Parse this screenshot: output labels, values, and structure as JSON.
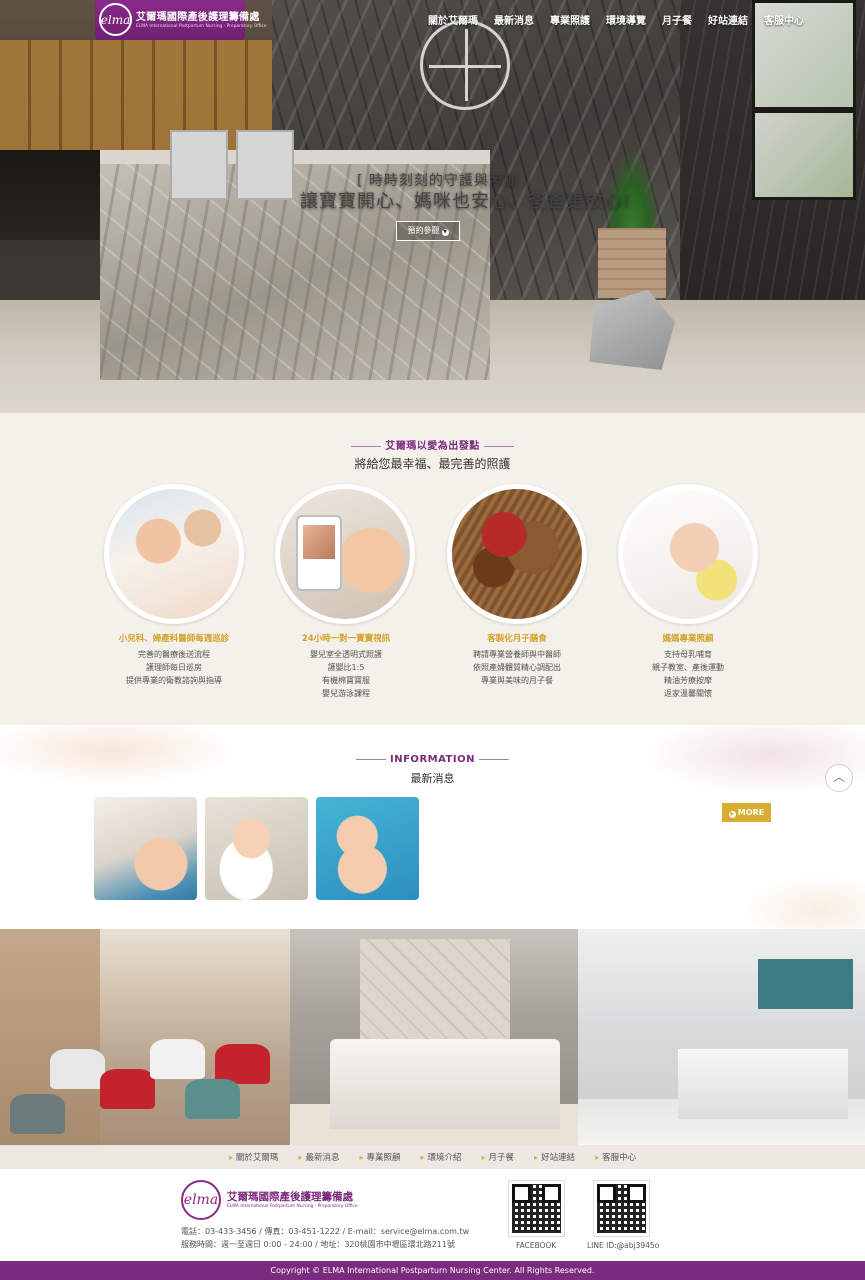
{
  "header": {
    "logo_mark": "elma",
    "logo_name": "艾爾瑪國際產後護理籌備處",
    "logo_sub": "ELMA International Postpartum Nursing · Preparatory Office",
    "nav": [
      "關於艾爾瑪",
      "最新消息",
      "專業照護",
      "環境導覽",
      "月子餐",
      "好站連結",
      "客服中心"
    ]
  },
  "hero": {
    "subtitle": "[ 時時刻刻的守護與照顧 ]",
    "title": "讓寶寶開心、媽咪也安心、爸爸更放心!",
    "button_label": "預約參觀",
    "button_icon": "chevron-down-icon"
  },
  "services": {
    "title": "艾爾瑪以愛為出發點",
    "subtitle": "將給您最幸福、最完善的照護",
    "items": [
      {
        "heading": "小兒科、婦產科醫師每週巡診",
        "lines": [
          "完善的醫療後送流程",
          "護理師每日巡房",
          "提供專業的衛教諮詢與指導"
        ]
      },
      {
        "heading": "24小時一對一寶寶視訊",
        "lines": [
          "嬰兒室全透明式照護",
          "護嬰比1:5",
          "有機棉寶寶服",
          "嬰兒游泳課程"
        ]
      },
      {
        "heading": "客製化月子膳食",
        "lines": [
          "聘請專業營養師與中醫師",
          "依照產婦體質精心調配出",
          "專業與美味的月子餐"
        ]
      },
      {
        "heading": "媽媽專業照顧",
        "lines": [
          "支持母乳哺育",
          "親子教室、產後運動",
          "精油芳療按摩",
          "返家溫馨關懷"
        ]
      }
    ]
  },
  "information": {
    "title": "INFORMATION",
    "subtitle": "最新消息",
    "more_label": "MORE",
    "top_icon": "chevron-up-icon"
  },
  "footer": {
    "nav": [
      "關於艾爾瑪",
      "最新消息",
      "專業照顧",
      "環境介紹",
      "月子餐",
      "好站連結",
      "客服中心"
    ],
    "logo_mark": "elma",
    "name": "艾爾瑪國際產後護理籌備處",
    "name_sub": "ELMA International Postpartum Nursing · Preparatory Office",
    "contact_line": "電話：03-433-3456  /  傳真：03-451-1222  /  E-mail：service@elma.com.tw",
    "hours_line": "服務時間：週一至週日 0:00 - 24:00  /  地址：320桃園市中壢區環北路211號",
    "qr_facebook_label": "FACEBOOK",
    "qr_line_label": "LINE ID:@abj3945o",
    "copyright": "Copyright © ELMA International Postparturn Nursing Center. All Rights Reserved."
  }
}
